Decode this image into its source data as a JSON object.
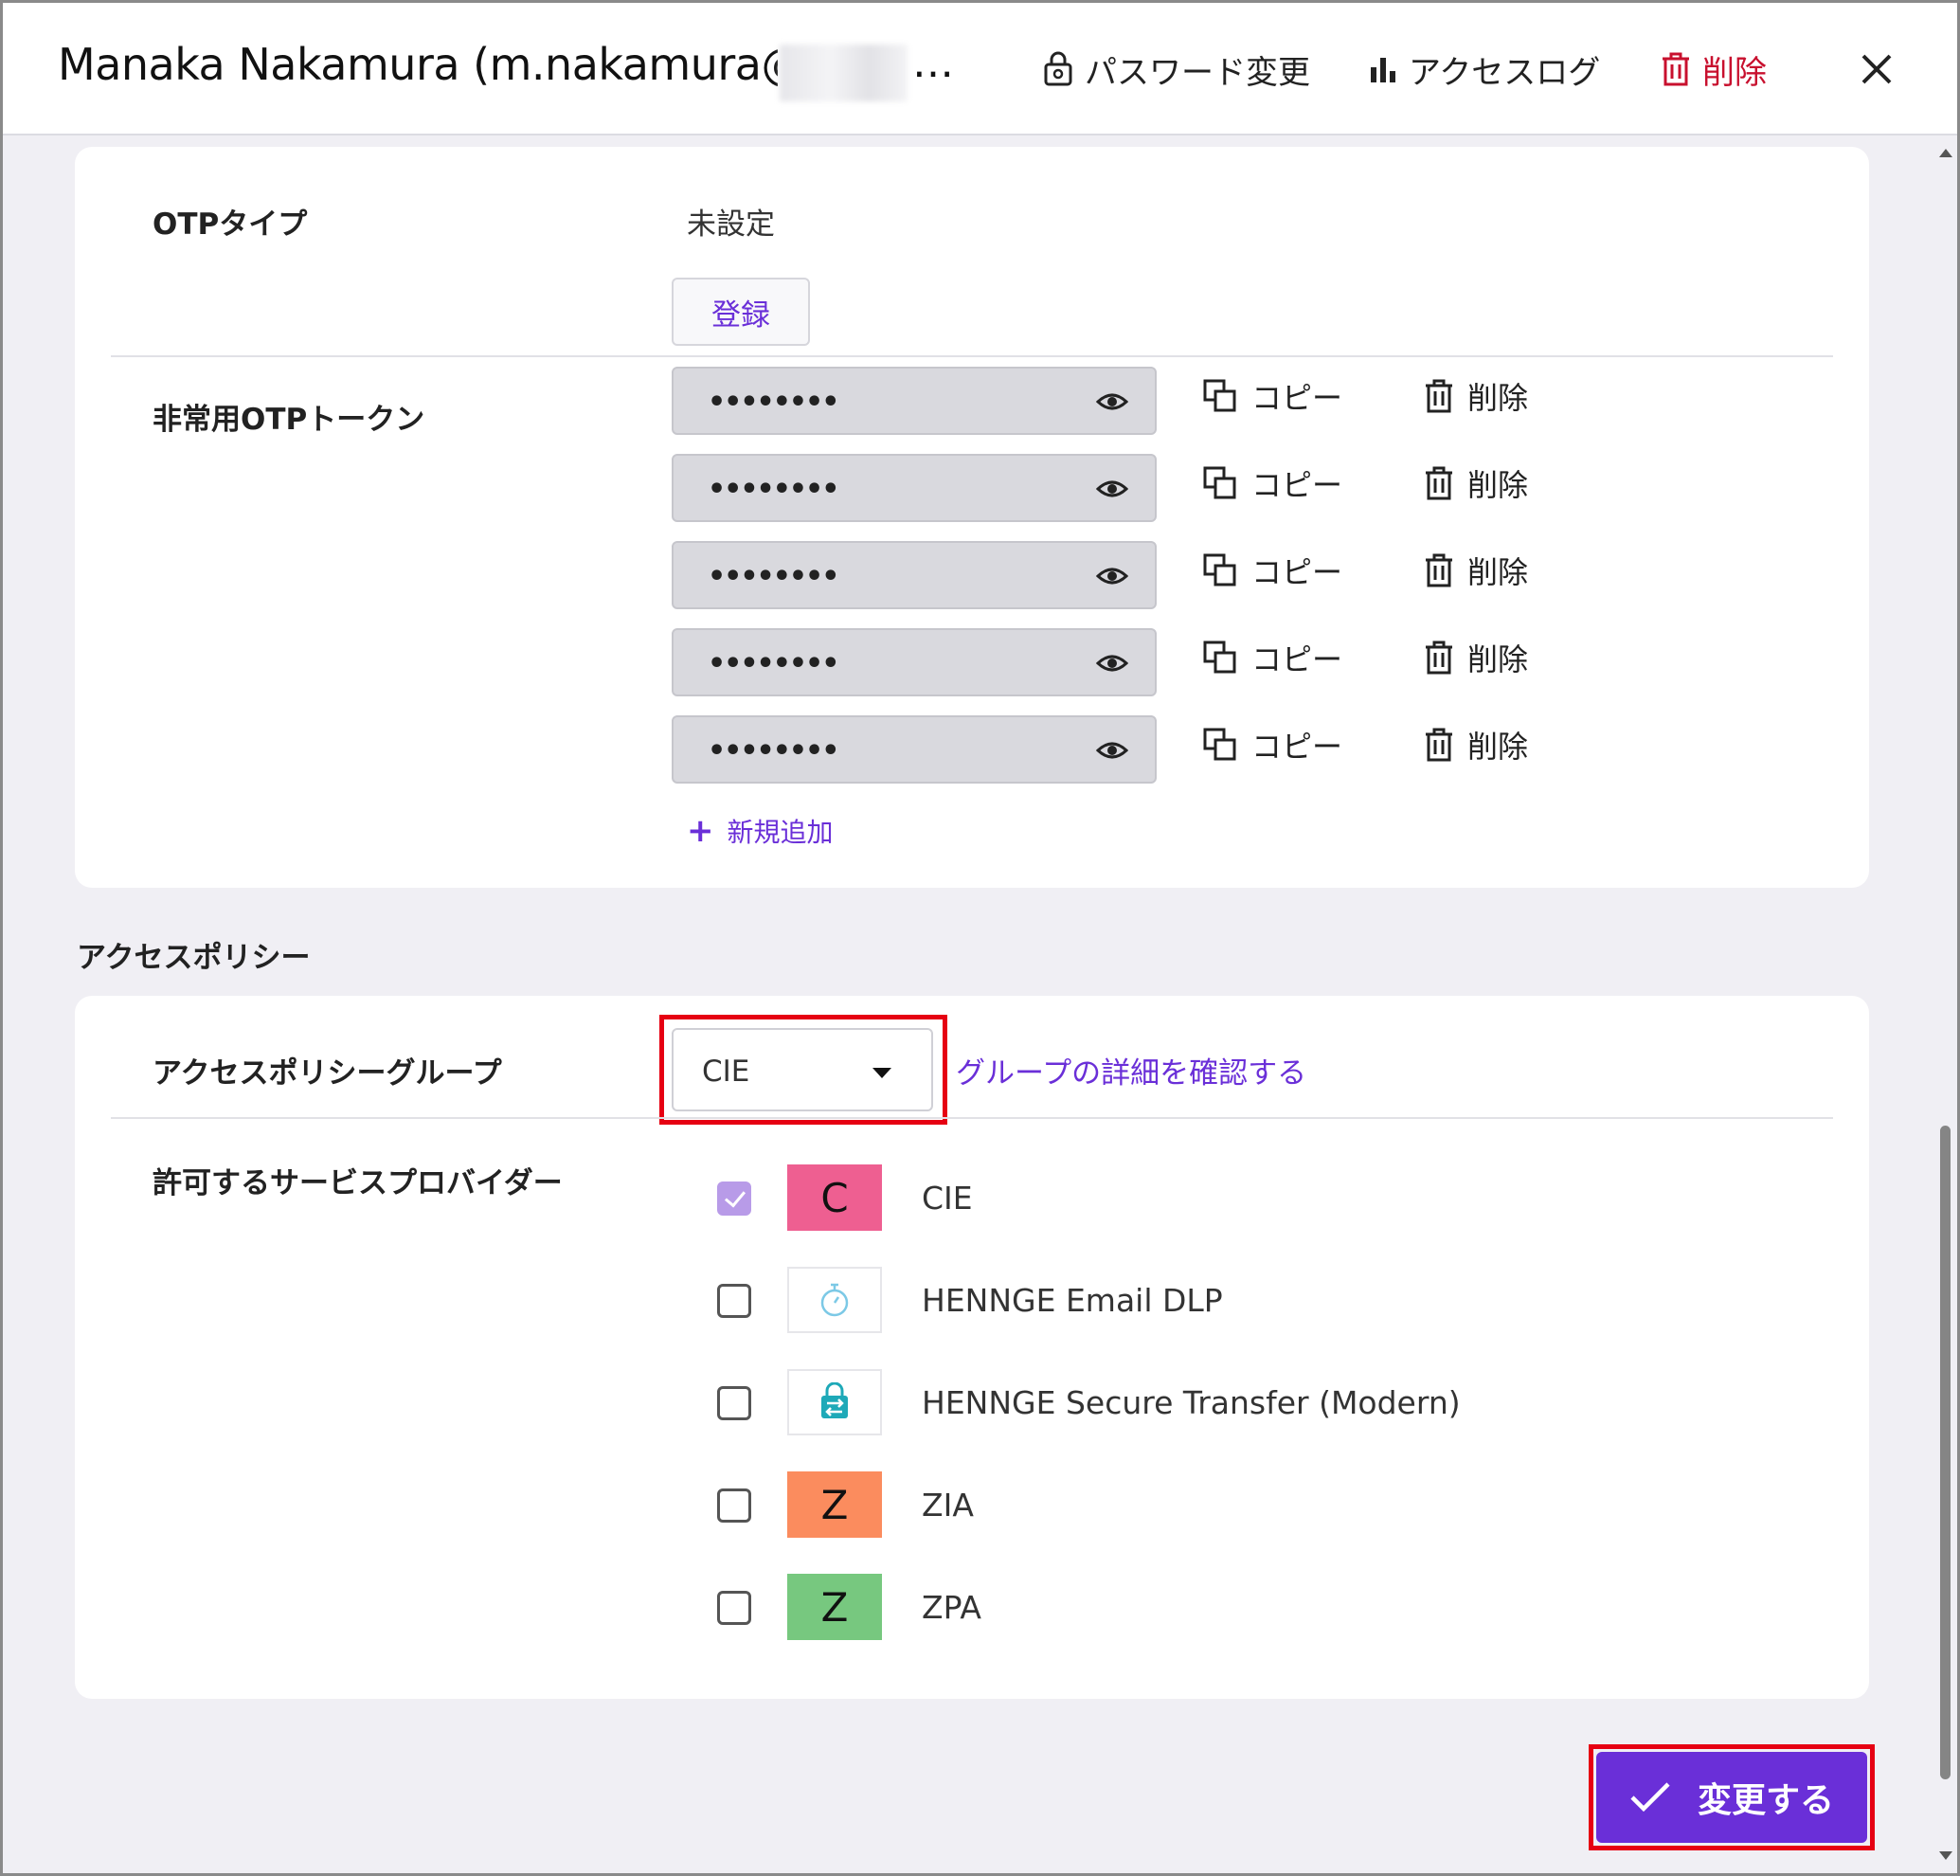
{
  "header": {
    "title": "Manaka Nakamura (m.nakamura@",
    "title_ellipsis": "…",
    "password_change": "パスワード変更",
    "access_log": "アクセスログ",
    "delete": "削除"
  },
  "otp": {
    "type_label": "OTPタイプ",
    "type_value": "未設定",
    "register_button": "登録",
    "emergency_label": "非常用OTPトークン",
    "tokens": [
      {
        "masked": "••••••••",
        "copy": "コピー",
        "delete": "削除"
      },
      {
        "masked": "••••••••",
        "copy": "コピー",
        "delete": "削除"
      },
      {
        "masked": "••••••••",
        "copy": "コピー",
        "delete": "削除"
      },
      {
        "masked": "••••••••",
        "copy": "コピー",
        "delete": "削除"
      },
      {
        "masked": "••••••••",
        "copy": "コピー",
        "delete": "削除"
      }
    ],
    "add_new": "新規追加"
  },
  "access_policy": {
    "section_title": "アクセスポリシー",
    "group_label": "アクセスポリシーグループ",
    "group_value": "CIE",
    "details_link": "グループの詳細を確認する",
    "providers_label": "許可するサービスプロバイダー",
    "providers": [
      {
        "name": "CIE",
        "letter": "C",
        "checked": true,
        "color": "#ee5f91"
      },
      {
        "name": "HENNGE Email DLP",
        "letter": "",
        "checked": false,
        "icon": "stopwatch-icon"
      },
      {
        "name": "HENNGE Secure Transfer (Modern)",
        "letter": "",
        "checked": false,
        "icon": "secure-transfer-icon"
      },
      {
        "name": "ZIA",
        "letter": "Z",
        "checked": false,
        "color": "#fb8c5e"
      },
      {
        "name": "ZPA",
        "letter": "Z",
        "checked": false,
        "color": "#77c87f"
      }
    ]
  },
  "footer": {
    "submit": "変更する"
  },
  "colors": {
    "accent": "#6a2fd8",
    "danger": "#c8102e",
    "highlight_frame": "#e60012"
  }
}
